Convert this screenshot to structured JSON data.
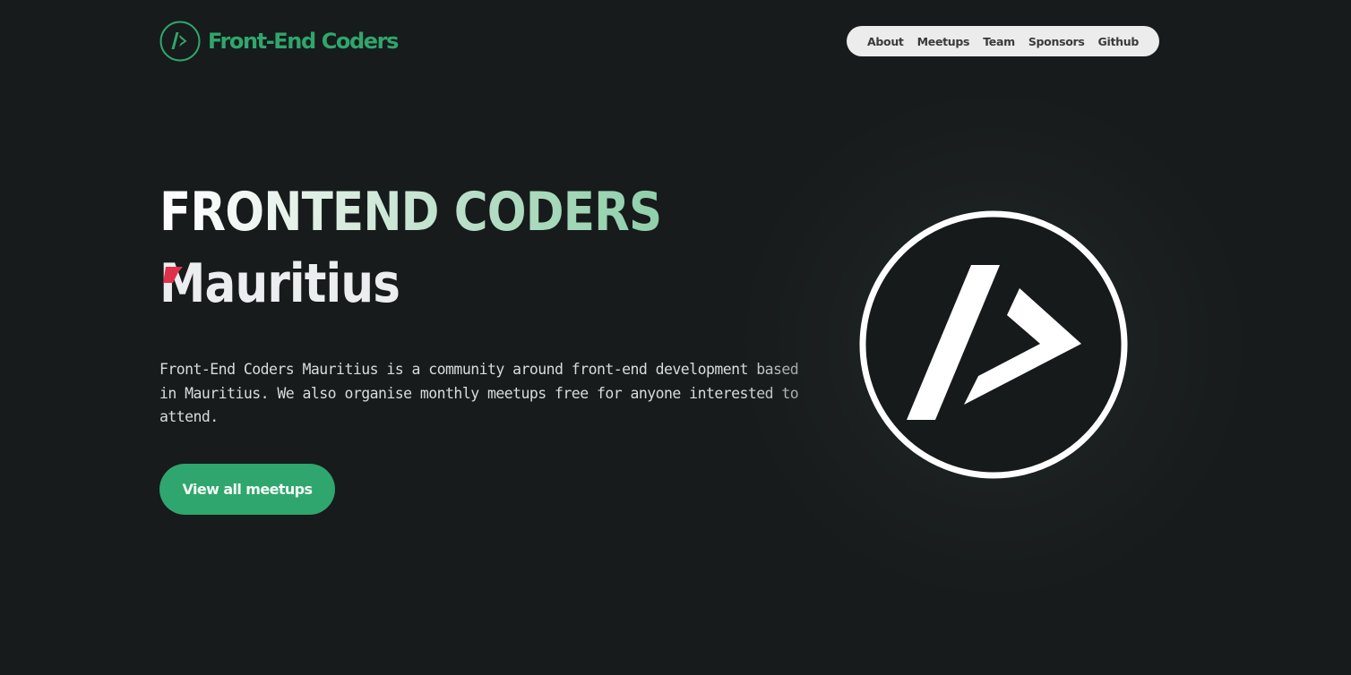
{
  "header": {
    "brand": "Front-End Coders",
    "nav": {
      "about": "About",
      "meetups": "Meetups",
      "team": "Team",
      "sponsors": "Sponsors",
      "github": "Github"
    }
  },
  "hero": {
    "title_line1": "FRONTEND CODERS",
    "title_line2": "Mauritius",
    "description": "Front-End Coders Mauritius is a community around front-end development based in Mauritius. We also organise monthly meetups free for anyone interested to attend.",
    "cta_label": "View all meetups"
  },
  "icons": {
    "brand_logo": "front-end-coders-logo-icon",
    "hero_logo": "front-end-coders-logo-icon",
    "title_accent": "red-flag-accent-icon"
  },
  "colors": {
    "background": "#171b1b",
    "brand_green": "#2fa66d",
    "nav_background": "#ececec",
    "accent_red": "#e0314b"
  }
}
